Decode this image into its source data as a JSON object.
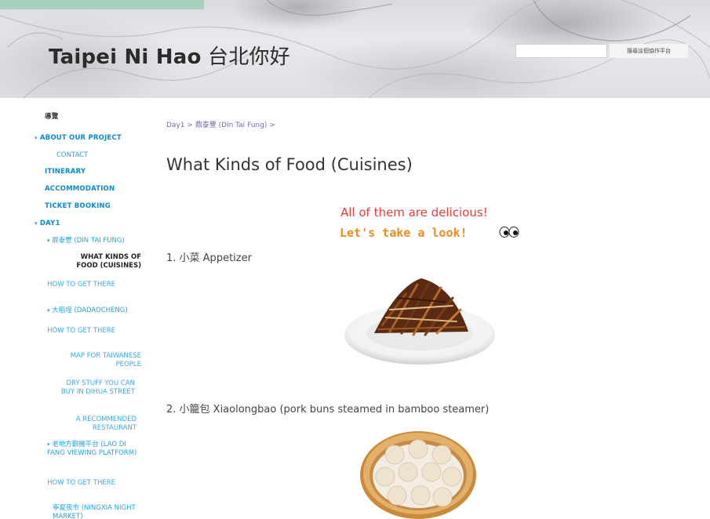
{
  "header": {
    "site_title_latin": "Taipei Ni Hao",
    "site_title_cjk": "台北你好",
    "search_placeholder": "",
    "search_button_label": "搜尋這個協作平台"
  },
  "sidebar": {
    "items": [
      {
        "label": "導覽",
        "level": 0,
        "style": "dark"
      },
      {
        "label": "ABOUT OUR PROJECT",
        "level": 0,
        "bullet": true
      },
      {
        "label": "CONTACT",
        "level": 1
      },
      {
        "label": "ITINERARY",
        "level": 0
      },
      {
        "label": "ACCOMMODATION",
        "level": 0
      },
      {
        "label": "TICKET BOOKING",
        "level": 0
      },
      {
        "label": "DAY1",
        "level": 0,
        "bullet": true
      },
      {
        "label": "鼎泰豐 (DIN TAI FUNG)",
        "level": 1,
        "bullet": true
      },
      {
        "label": "WHAT KINDS OF FOOD (CUISINES)",
        "level": 2,
        "active": true
      },
      {
        "label": "HOW TO GET THERE",
        "level": 2
      },
      {
        "label": "大稻埕 (DADAOCHENG)",
        "level": 1,
        "bullet": true
      },
      {
        "label": "HOW TO GET THERE",
        "level": 2
      },
      {
        "label": "MAP FOR TAIWANESE PEOPLE",
        "level": 2
      },
      {
        "label": "DRY STUFF YOU CAN BUY IN DIHUA STREET",
        "level": 2
      },
      {
        "label": "A RECOMMENDED RESTAURANT",
        "level": 2
      },
      {
        "label": "老地方觀機平台 (LAO DI FANG VIEWING PLATFORM)",
        "level": 1,
        "bullet": true
      },
      {
        "label": "HOW TO GET THERE",
        "level": 2
      },
      {
        "label": "寧夏夜市 (NINGXIA NIGHT MARKET)",
        "level": 1
      }
    ]
  },
  "main": {
    "breadcrumb": "Day1 > 鼎泰豐 (Din Tai Fung) >",
    "title": "What Kinds of Food (Cuisines)",
    "highlight_red": "All of them are delicious!",
    "highlight_orange": "Let's take a look!",
    "item1": "1. 小菜 Appetizer",
    "item2": "2. 小籠包 Xiaolongbao (pork buns steamed in bamboo steamer)"
  },
  "colors": {
    "nav_link": "#0b8ad2",
    "nav_sub": "#23a3df",
    "red_text": "#ef3a3a",
    "orange_text": "#ee8c1f",
    "breadcrumb": "#6e6ea8"
  },
  "icons": {
    "eyes": "eyes-emoji",
    "bullet": "triangle-bullet-icon"
  }
}
